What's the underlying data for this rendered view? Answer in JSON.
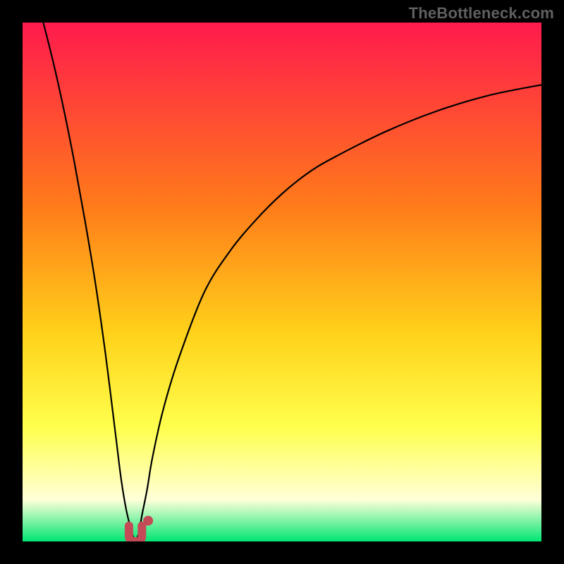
{
  "watermark": "TheBottleneck.com",
  "colors": {
    "frame": "#000000",
    "grad_top": "#ff1a4d",
    "grad_mid1": "#ff7a1a",
    "grad_mid2": "#ffd21a",
    "grad_mid3": "#ffff4d",
    "grad_pale": "#ffffd9",
    "grad_bottom": "#00e673",
    "curve": "#000000",
    "marker": "#c44a57"
  },
  "chart_data": {
    "type": "line",
    "title": "",
    "xlabel": "",
    "ylabel": "",
    "xlim": [
      0,
      100
    ],
    "ylim": [
      0,
      100
    ],
    "annotations": [],
    "series": [
      {
        "name": "bottleneck-curve",
        "x": [
          4,
          6,
          8,
          10,
          12,
          14,
          16,
          18,
          19,
          20,
          21,
          21.5,
          22,
          22.5,
          23,
          24,
          25,
          27,
          30,
          35,
          40,
          45,
          50,
          55,
          60,
          70,
          80,
          90,
          100
        ],
        "values": [
          100,
          92,
          83,
          73,
          62,
          50,
          36,
          20,
          12,
          6,
          2,
          0.5,
          0.6,
          2,
          5,
          10,
          16,
          25,
          35,
          48,
          56,
          62,
          67,
          71,
          74,
          79,
          83,
          86,
          88
        ]
      }
    ],
    "markers": [
      {
        "name": "highlight-min",
        "x_range": [
          20.5,
          23.0
        ],
        "y_range": [
          0.0,
          3.0
        ]
      },
      {
        "name": "highlight-dot",
        "x": 24.2,
        "y": 4.0
      }
    ],
    "legend": []
  }
}
